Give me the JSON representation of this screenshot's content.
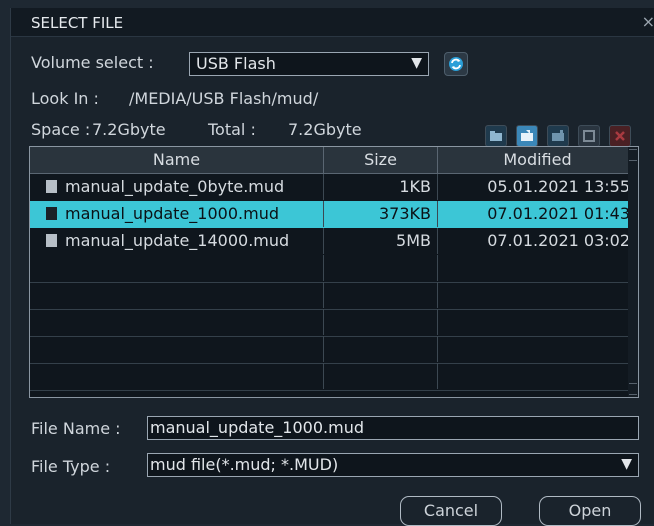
{
  "dialog": {
    "title": "SELECT FILE",
    "close_glyph": "×"
  },
  "volume": {
    "label": "Volume select :",
    "value": "USB Flash",
    "arrow": "▼"
  },
  "look_in": {
    "label": "Look In :",
    "path": "/MEDIA/USB Flash/mud/"
  },
  "space": {
    "label": "Space :",
    "value": "7.2Gbyte",
    "total_label": "Total :",
    "total_value": "7.2Gbyte"
  },
  "toolbar_icons": [
    "folder-up-icon",
    "folder-open-icon",
    "new-folder-icon",
    "rename-icon",
    "delete-icon"
  ],
  "columns": {
    "name": "Name",
    "size": "Size",
    "modified": "Modified"
  },
  "files": [
    {
      "name": "manual_update_0byte.mud",
      "size": "1KB",
      "modified": "05.01.2021 13:55"
    },
    {
      "name": "manual_update_1000.mud",
      "size": "373KB",
      "modified": "07.01.2021 01:43"
    },
    {
      "name": "manual_update_14000.mud",
      "size": "5MB",
      "modified": "07.01.2021 03:02"
    }
  ],
  "selected_index": 1,
  "file_name": {
    "label": "File Name :",
    "value": "manual_update_1000.mud"
  },
  "file_type": {
    "label": "File Type :",
    "value": "mud file(*.mud; *.MUD)",
    "arrow": "▼"
  },
  "buttons": {
    "cancel": "Cancel",
    "open": "Open"
  },
  "colors": {
    "selection": "#3cc6d6",
    "background": "#1a232c"
  }
}
